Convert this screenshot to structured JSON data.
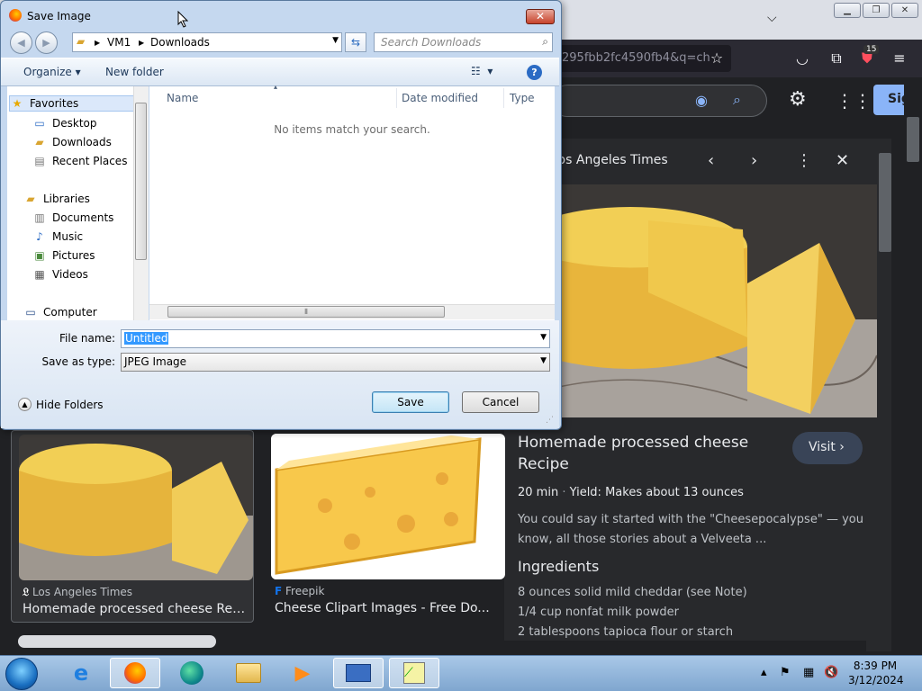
{
  "browser": {
    "url_fragment": "295fbb2fc4590fb4&q=ch",
    "extension_badge": "15",
    "signin_label": "Sig"
  },
  "viewer": {
    "source": "Los Angeles Times",
    "title": "Homemade processed cheese Recipe",
    "visit_label": "Visit",
    "time": "20 min",
    "yield": "Yield: Makes about 13 ounces",
    "description": "You could say it started with the \"Cheesepocalypse\" — you know, all those stories about a Velveeta ...",
    "ingredients_title": "Ingredients",
    "ingredients": [
      "8 ounces solid mild cheddar (see Note)",
      "1/4 cup nonfat milk powder",
      "2 tablespoons tapioca flour or starch"
    ]
  },
  "results": [
    {
      "source": "Los Angeles Times",
      "title": "Homemade processed cheese Recip..."
    },
    {
      "source": "Freepik",
      "title": "Cheese Clipart Images - Free Do..."
    }
  ],
  "dialog": {
    "title": "Save Image",
    "breadcrumb": [
      "VM1",
      "Downloads"
    ],
    "search_placeholder": "Search Downloads",
    "toolbar": {
      "organize": "Organize",
      "new_folder": "New folder"
    },
    "nav": {
      "favorites": "Favorites",
      "desktop": "Desktop",
      "downloads": "Downloads",
      "recent": "Recent Places",
      "libraries": "Libraries",
      "documents": "Documents",
      "music": "Music",
      "pictures": "Pictures",
      "videos": "Videos",
      "computer": "Computer"
    },
    "columns": {
      "name": "Name",
      "date": "Date modified",
      "type": "Type"
    },
    "empty_message": "No items match your search.",
    "file_name_label": "File name:",
    "file_name_value": "Untitled",
    "save_type_label": "Save as type:",
    "save_type_value": "JPEG Image",
    "hide_folders": "Hide Folders",
    "save_label": "Save",
    "cancel_label": "Cancel"
  },
  "taskbar": {
    "time": "8:39 PM",
    "date": "3/12/2024"
  },
  "colors": {
    "dialog_bg": "#c5d8ef",
    "google_bg": "#202124",
    "accent": "#8ab4f8"
  }
}
